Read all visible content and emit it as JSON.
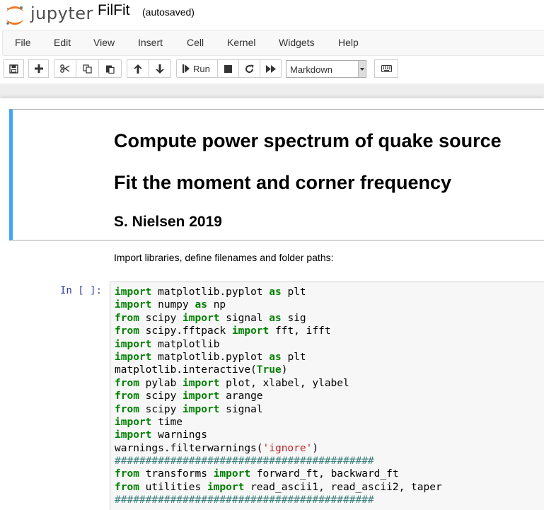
{
  "header": {
    "logo_text": "jupyter",
    "notebook_name": "FilFit",
    "autosave_status": "(autosaved)"
  },
  "menu": {
    "items": [
      "File",
      "Edit",
      "View",
      "Insert",
      "Cell",
      "Kernel",
      "Widgets",
      "Help"
    ]
  },
  "toolbar": {
    "run_label": "Run",
    "cell_type": "Markdown",
    "icons": [
      "save-icon",
      "plus-icon",
      "cut-icon",
      "copy-icon",
      "paste-icon",
      "arrow-up-icon",
      "arrow-down-icon",
      "step-forward-icon",
      "stop-icon",
      "refresh-icon",
      "fast-forward-icon",
      "keyboard-icon"
    ]
  },
  "markdown_cell": {
    "heading1a": "Compute power spectrum of quake source",
    "heading1b": "Fit the moment and corner frequency",
    "heading2": "S. Nielsen 2019"
  },
  "text_cell": {
    "text": "Import libraries, define filenames and folder paths:"
  },
  "code_cell": {
    "prompt": "In [ ]:",
    "lines": [
      [
        [
          "kw",
          "import"
        ],
        [
          "t",
          " matplotlib.pyplot "
        ],
        [
          "kw",
          "as"
        ],
        [
          "t",
          " plt"
        ]
      ],
      [
        [
          "kw",
          "import"
        ],
        [
          "t",
          " numpy "
        ],
        [
          "kw",
          "as"
        ],
        [
          "t",
          " np"
        ]
      ],
      [
        [
          "kw",
          "from"
        ],
        [
          "t",
          " scipy "
        ],
        [
          "kw",
          "import"
        ],
        [
          "t",
          " signal "
        ],
        [
          "kw",
          "as"
        ],
        [
          "t",
          " sig"
        ]
      ],
      [
        [
          "kw",
          "from"
        ],
        [
          "t",
          " scipy.fftpack "
        ],
        [
          "kw",
          "import"
        ],
        [
          "t",
          " fft, ifft"
        ]
      ],
      [
        [
          "kw",
          "import"
        ],
        [
          "t",
          " matplotlib"
        ]
      ],
      [
        [
          "kw",
          "import"
        ],
        [
          "t",
          " matplotlib.pyplot "
        ],
        [
          "kw",
          "as"
        ],
        [
          "t",
          " plt"
        ]
      ],
      [
        [
          "t",
          "matplotlib.interactive("
        ],
        [
          "kw",
          "True"
        ],
        [
          "t",
          ")"
        ]
      ],
      [
        [
          "kw",
          "from"
        ],
        [
          "t",
          " pylab "
        ],
        [
          "kw",
          "import"
        ],
        [
          "t",
          " plot, xlabel, ylabel"
        ]
      ],
      [
        [
          "kw",
          "from"
        ],
        [
          "t",
          " scipy "
        ],
        [
          "kw",
          "import"
        ],
        [
          "t",
          " arange"
        ]
      ],
      [
        [
          "kw",
          "from"
        ],
        [
          "t",
          " scipy "
        ],
        [
          "kw",
          "import"
        ],
        [
          "t",
          " signal"
        ]
      ],
      [
        [
          "kw",
          "import"
        ],
        [
          "t",
          " time"
        ]
      ],
      [
        [
          "kw",
          "import"
        ],
        [
          "t",
          " warnings"
        ]
      ],
      [
        [
          "t",
          "warnings.filterwarnings("
        ],
        [
          "str",
          "'ignore'"
        ],
        [
          "t",
          ")"
        ]
      ],
      [
        [
          "cm",
          "##########################################"
        ]
      ],
      [
        [
          "kw",
          "from"
        ],
        [
          "t",
          " transforms "
        ],
        [
          "kw",
          "import"
        ],
        [
          "t",
          " forward_ft, backward_ft"
        ]
      ],
      [
        [
          "kw",
          "from"
        ],
        [
          "t",
          " utilities "
        ],
        [
          "kw",
          "import"
        ],
        [
          "t",
          " read_ascii1, read_ascii2, taper"
        ]
      ],
      [
        [
          "cm",
          "##########################################"
        ]
      ]
    ]
  },
  "colors": {
    "keyword": "#008000",
    "string": "#ba2121",
    "comment": "#408080",
    "prompt": "#303f9f",
    "selected_cell_bar": "#42a5f5"
  }
}
